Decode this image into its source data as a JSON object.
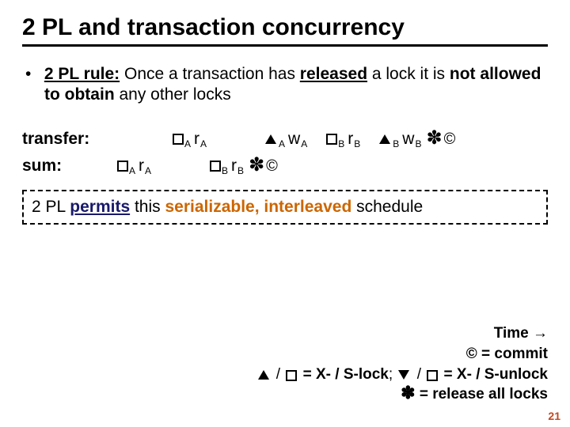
{
  "title": "2 PL and transaction concurrency",
  "rule": {
    "lead": "2 PL rule:",
    "mid1": " Once a transaction has ",
    "released": "released",
    "mid2": " a lock it is ",
    "not_allowed": "not allowed to obtain",
    "tail": " any other locks"
  },
  "rows": {
    "transfer": {
      "label": "transfer:",
      "tokens": [
        {
          "shape": "square",
          "sub": "A",
          "text": "",
          "gap": "md"
        },
        {
          "shape": "",
          "sub": "A",
          "text": "r",
          "gap": ""
        },
        {
          "shape": "tri-up",
          "sub": "A",
          "text": "",
          "gap": "md"
        },
        {
          "shape": "",
          "sub": "A",
          "text": "w",
          "gap": ""
        },
        {
          "shape": "square",
          "sub": "B",
          "text": "",
          "gap": "sm"
        },
        {
          "shape": "",
          "sub": "B",
          "text": "r",
          "gap": ""
        },
        {
          "shape": "tri-up",
          "sub": "B",
          "text": "",
          "gap": "sm"
        },
        {
          "shape": "",
          "sub": "B",
          "text": "w",
          "gap": ""
        }
      ],
      "release": true,
      "commit": true
    },
    "sum": {
      "label": "sum:",
      "tokens": [
        {
          "shape": "square",
          "sub": "A",
          "text": "",
          "gap": ""
        },
        {
          "shape": "",
          "sub": "A",
          "text": "r",
          "gap": ""
        },
        {
          "shape": "square",
          "sub": "B",
          "text": "",
          "gap": "md"
        },
        {
          "shape": "",
          "sub": "B",
          "text": "r",
          "gap": ""
        }
      ],
      "release": true,
      "commit": true
    }
  },
  "callout": {
    "pre": "2 PL ",
    "permits": "permits",
    "mid": " this ",
    "adj": "serializable, interleaved",
    "post": " schedule"
  },
  "legend": {
    "time": "Time →",
    "commit": "© = commit",
    "lock_sep1": " / ",
    "lock_tail1": " = X- / S-lock",
    "lock_sep2": "; ",
    "lock_sep3": " / ",
    "lock_tail2": " = X- / S-unlock",
    "release": " = release all locks"
  },
  "symbols": {
    "release": "✽",
    "commit": "©"
  },
  "pagenum": "21"
}
